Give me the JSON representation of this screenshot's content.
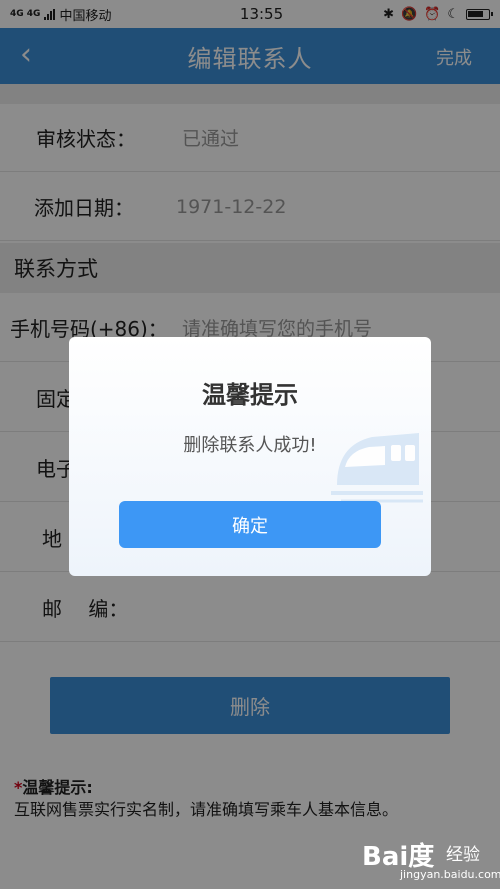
{
  "status_bar": {
    "signal_label": "4G 4G",
    "carrier": "中国移动",
    "time": "13:55"
  },
  "nav": {
    "title": "编辑联系人",
    "done_label": "完成"
  },
  "fields": {
    "review_status": {
      "label": "审核状态：",
      "value": "已通过"
    },
    "added_date": {
      "label": "添加日期：",
      "value": "1971-12-22"
    },
    "contact_section": "联系方式",
    "mobile": {
      "label": "手机号码(+86)：",
      "placeholder": "请准确填写您的手机号"
    },
    "landline": {
      "label": "固定"
    },
    "email": {
      "label": "电子"
    },
    "address": {
      "label": "地"
    },
    "postcode": {
      "label": "邮　 编："
    }
  },
  "delete_button": {
    "label": "删除"
  },
  "tip": {
    "title": "温馨提示:",
    "text": "互联网售票实行实名制，请准确填写乘车人基本信息。"
  },
  "dialog": {
    "title": "温馨提示",
    "message": "删除联系人成功!",
    "ok_label": "确定"
  },
  "watermark": {
    "logo": "Bai",
    "logo_suffix": "度",
    "label": "经验",
    "url": "jingyan.baidu.com"
  },
  "colors": {
    "primary": "#3b8fd8",
    "dialog_button": "#3d97f5"
  }
}
